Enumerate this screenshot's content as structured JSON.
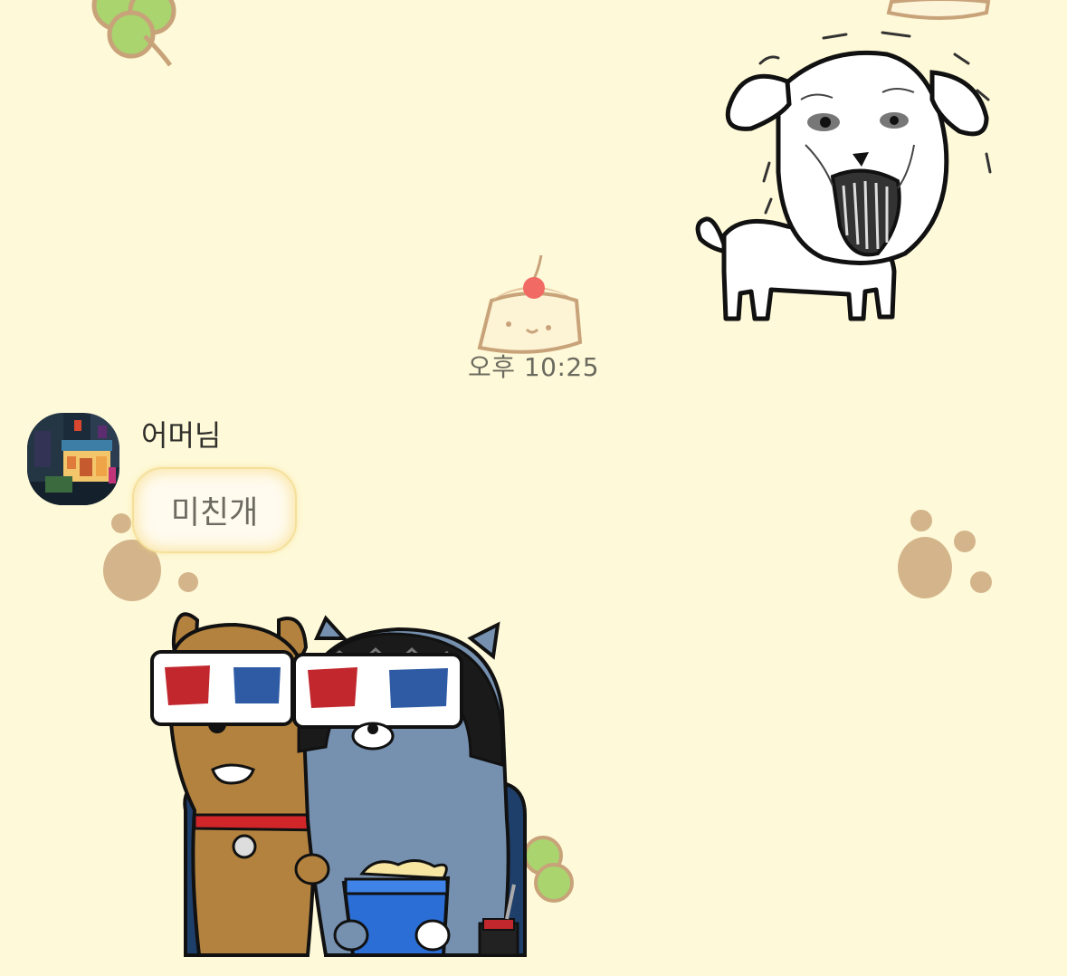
{
  "chat": {
    "timestamp": "오후 10:25",
    "messages": [
      {
        "sender": "어머님",
        "text": "미친개",
        "avatar_icon": "night-storefront-photo-icon"
      }
    ]
  },
  "stickers": {
    "sent": "dog-howling-sticker",
    "received": "frodo-neo-3d-glasses-popcorn-sticker"
  },
  "background": {
    "color": "#fef9d8",
    "motifs": [
      "clover-icon",
      "pudding-icon",
      "paw-print-icon"
    ]
  }
}
